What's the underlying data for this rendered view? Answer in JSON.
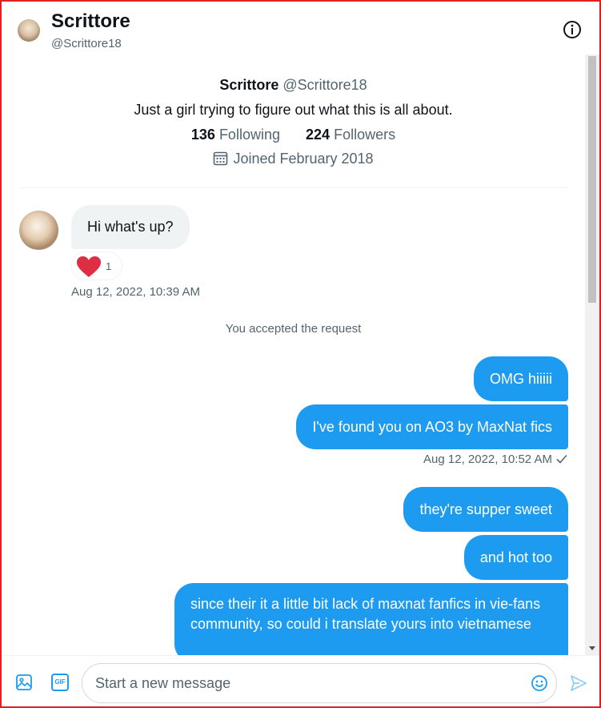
{
  "header": {
    "name": "Scrittore",
    "handle": "@Scrittore18",
    "info_icon": "info-icon"
  },
  "profile": {
    "name": "Scrittore",
    "handle": "@Scrittore18",
    "bio": "Just a girl trying to figure out what this is all about.",
    "following_count": "136",
    "following_label": "Following",
    "followers_count": "224",
    "followers_label": "Followers",
    "joined": "Joined February 2018",
    "joined_icon": "calendar-icon"
  },
  "conversation": {
    "incoming": {
      "text": "Hi what's up?",
      "reaction_emoji": "heart",
      "reaction_count": "1",
      "timestamp": "Aug 12, 2022, 10:39 AM"
    },
    "system_notice": "You accepted the request",
    "outgoing_group_1": {
      "messages": [
        "OMG hiiiii",
        "I've found you on AO3 by MaxNat fics"
      ],
      "timestamp": "Aug 12, 2022, 10:52 AM",
      "status_icon": "check-icon"
    },
    "outgoing_group_2": {
      "messages": [
        "they're supper sweet",
        "and hot too",
        "since their it a little bit lack of maxnat fanfics in vie-fans community, so could i translate yours into vietnamese"
      ]
    }
  },
  "composer": {
    "placeholder": "Start a new message",
    "media_icon": "image-icon",
    "gif_label": "GIF",
    "emoji_icon": "emoji-icon",
    "send_icon": "send-icon"
  },
  "colors": {
    "accent": "#1d9bf0",
    "incoming_bubble": "#eff3f4",
    "secondary_text": "#536471",
    "frame": "#e02020"
  }
}
